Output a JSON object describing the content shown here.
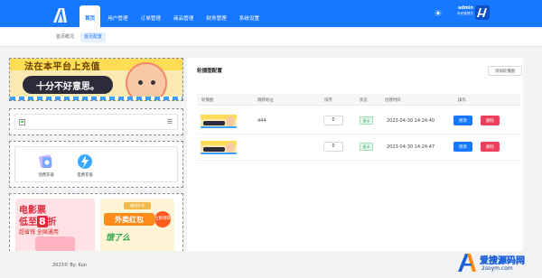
{
  "header": {
    "logo": "app-logo",
    "nav": [
      {
        "label": "首页",
        "active": true
      },
      {
        "label": "用户管理",
        "active": false
      },
      {
        "label": "订单管理",
        "active": false
      },
      {
        "label": "商品管理",
        "active": false
      },
      {
        "label": "财务管理",
        "active": false
      },
      {
        "label": "系统设置",
        "active": false
      }
    ],
    "theme_icon": "sun-icon",
    "user": {
      "name": "admin",
      "role": "系统管理员"
    },
    "avatar_icon": "user-avatar"
  },
  "subtabs": [
    {
      "label": "首页概况",
      "active": false
    },
    {
      "label": "首页配置",
      "active": true
    }
  ],
  "preview": {
    "banner_top": {
      "line1": "法在本平台上充值",
      "line2": "十分不好意思。"
    },
    "broken_image_icon": "broken-image-icon",
    "menu_icon": "menu-icon",
    "quick_entries": [
      {
        "label": "话费充值",
        "icon": "phone-recharge-icon"
      },
      {
        "label": "电费充值",
        "icon": "electricity-recharge-icon"
      }
    ],
    "ad_movie": {
      "line1": "电影票",
      "line2_prefix": "低至",
      "line2_num": "8",
      "line2_suffix": "折",
      "line3": "超省钱 全国通用"
    },
    "ad_takeout": {
      "chip": "美团外卖",
      "title": "外卖红包",
      "badge": "立即领取",
      "subtitle": "饿了么"
    }
  },
  "panel": {
    "title": "轮播图配置",
    "add_button": "添加轮播图",
    "columns": [
      "轮播图",
      "跳转地址",
      "排序",
      "状态",
      "创建时间",
      "操作"
    ],
    "rows": [
      {
        "link": "444",
        "sort": "0",
        "status": "显示",
        "created": "2023-04-30 14:24:40",
        "edit": "修改",
        "delete": "删除"
      },
      {
        "link": "",
        "sort": "0",
        "status": "显示",
        "created": "2023-04-30 14:24:47",
        "edit": "修改",
        "delete": "删除"
      }
    ]
  },
  "footer": {
    "text": "2023© By: Kun"
  },
  "watermark": {
    "line1": "爱搜源码网",
    "line2": "2soym.com"
  },
  "colors": {
    "primary": "#1677ff",
    "danger": "#ee3f5c",
    "success": "#1aa34a"
  }
}
